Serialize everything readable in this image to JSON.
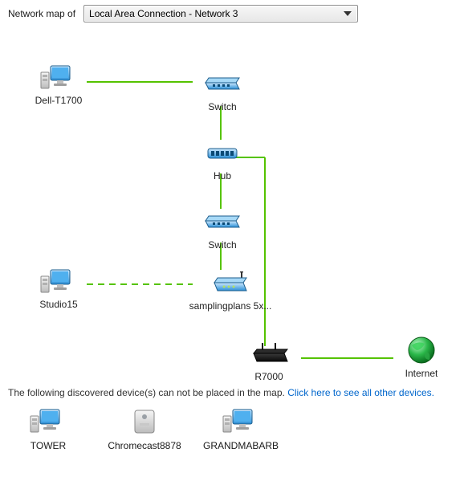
{
  "header": {
    "label": "Network map of",
    "selected": "Local Area Connection - Network 3"
  },
  "nodes": {
    "dell": {
      "label": "Dell-T1700"
    },
    "switch1": {
      "label": "Switch"
    },
    "hub": {
      "label": "Hub"
    },
    "switch2": {
      "label": "Switch"
    },
    "studio": {
      "label": "Studio15"
    },
    "sampling": {
      "label": "samplingplans 5x..."
    },
    "r7000": {
      "label": "R7000"
    },
    "internet": {
      "label": "Internet"
    }
  },
  "footer": {
    "text": "The following discovered device(s) can not be placed in the map.",
    "link": "Click here to see all other devices."
  },
  "unplaced": {
    "tower": {
      "label": "TOWER"
    },
    "chrome": {
      "label": "Chromecast8878"
    },
    "grandma": {
      "label": "GRANDMABARB"
    }
  }
}
